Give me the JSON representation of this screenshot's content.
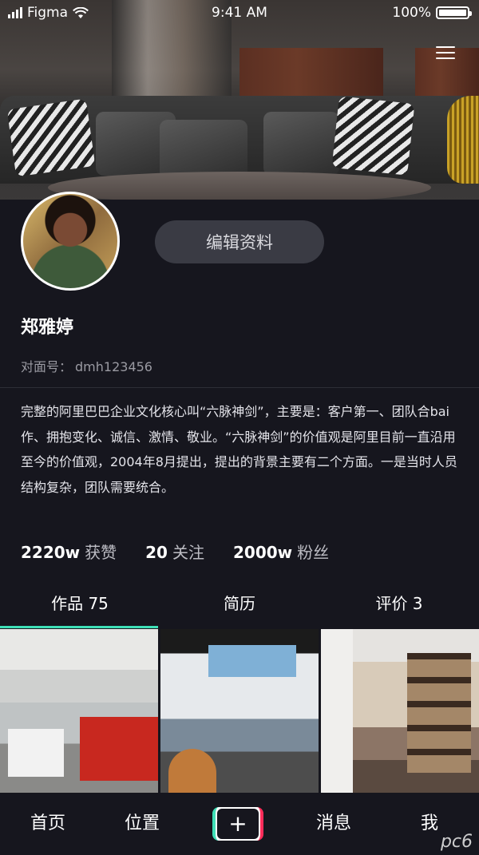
{
  "status_bar": {
    "carrier": "Figma",
    "time": "9:41 AM",
    "battery": "100%"
  },
  "profile": {
    "edit_button_label": "编辑资料",
    "name": "郑雅婷",
    "account_label": "对面号：",
    "account_id": "dmh123456",
    "bio": "完整的阿里巴巴企业文化核心叫“六脉神剑”，主要是：客户第一、团队合bai作、拥抱变化、诚信、激情、敬业。“六脉神剑”的价值观是阿里目前一直沿用至今的价值观，2004年8月提出，提出的背景主要有二个方面。一是当时人员结构复杂，团队需要统合。"
  },
  "stats": [
    {
      "value": "2220w",
      "label": "获赞"
    },
    {
      "value": "20",
      "label": "关注"
    },
    {
      "value": "2000w",
      "label": "粉丝"
    }
  ],
  "tabs": [
    {
      "label": "作品 75"
    },
    {
      "label": "简历"
    },
    {
      "label": "评价 3"
    }
  ],
  "bottom_nav": {
    "home": "首页",
    "location": "位置",
    "add": "+",
    "messages": "消息",
    "me": "我"
  },
  "watermark": "pc6",
  "colors": {
    "background": "#16161e",
    "accent_cyan": "#3ee0b7",
    "accent_red": "#ff2d5a",
    "button_bg": "#3a3b44"
  }
}
